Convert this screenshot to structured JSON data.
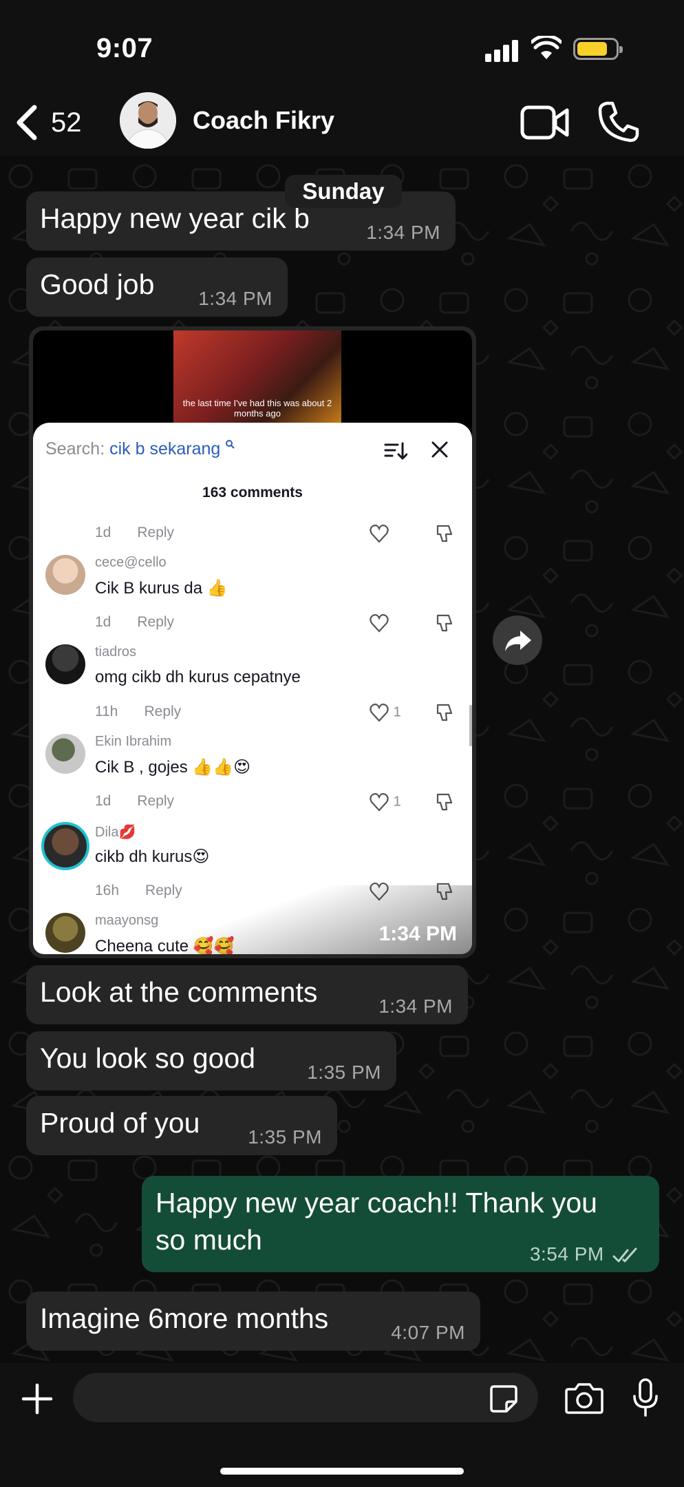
{
  "status_bar": {
    "time": "9:07"
  },
  "header": {
    "back_count": "52",
    "contact_name": "Coach Fikry"
  },
  "date_label": "Sunday",
  "messages": [
    {
      "text": "Happy new year cik b",
      "time": "1:34 PM",
      "direction": "in"
    },
    {
      "text": "Good job",
      "time": "1:34 PM",
      "direction": "in"
    },
    {
      "text": "Look at the comments",
      "time": "1:34 PM",
      "direction": "in"
    },
    {
      "text": "You look so good",
      "time": "1:35 PM",
      "direction": "in"
    },
    {
      "text": "Proud of you",
      "time": "1:35 PM",
      "direction": "in"
    },
    {
      "text": "Happy new year coach!! Thank you so much",
      "time": "3:54 PM",
      "direction": "out",
      "status": "read"
    },
    {
      "text": "Imagine 6more months",
      "time": "4:07 PM",
      "direction": "in"
    }
  ],
  "media": {
    "time": "1:34 PM",
    "video_caption": "the last time I've had this was about 2 months ago",
    "search_label": "Search:",
    "search_query": "cik b sekarang",
    "comment_count": "163 comments",
    "top_meta": {
      "age": "1d",
      "reply": "Reply"
    },
    "comments": [
      {
        "user": "cece@cello",
        "text": "Cik B kurus da 👍",
        "age": "1d",
        "reply": "Reply",
        "likes": ""
      },
      {
        "user": "tiadros",
        "text": "omg cikb dh kurus cepatnye",
        "age": "11h",
        "reply": "Reply",
        "likes": "1"
      },
      {
        "user": "Ekin Ibrahim",
        "text": "Cik B , gojes 👍👍😍",
        "age": "1d",
        "reply": "Reply",
        "likes": "1"
      },
      {
        "user": "Dila💋",
        "text": "cikb dh kurus😍",
        "age": "16h",
        "reply": "Reply",
        "likes": ""
      },
      {
        "user": "maayonsg",
        "text": "Cheena cute 🥰🥰",
        "age": "",
        "reply": "",
        "likes": ""
      }
    ]
  },
  "input": {
    "placeholder": ""
  },
  "colors": {
    "incoming_bubble": "#262626",
    "outgoing_bubble": "#144d37",
    "background": "#0c0c0c",
    "link_blue": "#2b5db9"
  }
}
